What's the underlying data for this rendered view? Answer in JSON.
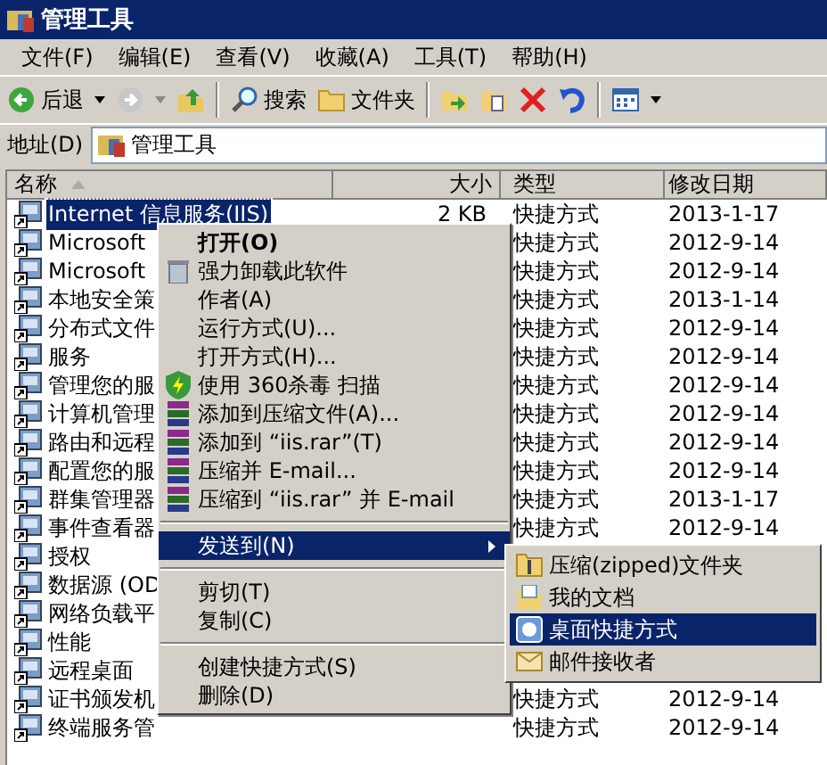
{
  "window": {
    "title": "管理工具"
  },
  "menu_bar": [
    "文件(F)",
    "编辑(E)",
    "查看(V)",
    "收藏(A)",
    "工具(T)",
    "帮助(H)"
  ],
  "toolbar": {
    "back": "后退",
    "search": "搜索",
    "folders": "文件夹"
  },
  "address_bar": {
    "label": "地址(D)",
    "value": "管理工具"
  },
  "table": {
    "columns": [
      {
        "label": "名称",
        "sorted": true
      },
      {
        "label": "大小",
        "sorted": false
      },
      {
        "label": "类型",
        "sorted": false
      },
      {
        "label": "修改日期",
        "sorted": false
      }
    ],
    "rows": [
      {
        "name": "Internet 信息服务(IIS)",
        "size": "2 KB",
        "type": "快捷方式",
        "modified": "2013-1-17",
        "selected": true
      },
      {
        "name": "Microsoft",
        "type": "快捷方式",
        "modified": "2012-9-14",
        "selected": false
      },
      {
        "name": "Microsoft",
        "type": "快捷方式",
        "modified": "2012-9-14",
        "selected": false
      },
      {
        "name": "本地安全策",
        "type": "快捷方式",
        "modified": "2013-1-14",
        "selected": false
      },
      {
        "name": "分布式文件",
        "type": "快捷方式",
        "modified": "2012-9-14",
        "selected": false
      },
      {
        "name": "服务",
        "type": "快捷方式",
        "modified": "2012-9-14",
        "selected": false
      },
      {
        "name": "管理您的服",
        "type": "快捷方式",
        "modified": "2012-9-14",
        "selected": false
      },
      {
        "name": "计算机管理",
        "type": "快捷方式",
        "modified": "2012-9-14",
        "selected": false
      },
      {
        "name": "路由和远程",
        "type": "快捷方式",
        "modified": "2012-9-14",
        "selected": false
      },
      {
        "name": "配置您的服",
        "type": "快捷方式",
        "modified": "2012-9-14",
        "selected": false
      },
      {
        "name": "群集管理器",
        "type": "快捷方式",
        "modified": "2013-1-17",
        "selected": false
      },
      {
        "name": "事件查看器",
        "type": "快捷方式",
        "modified": "2012-9-14",
        "selected": false
      },
      {
        "name": "授权",
        "selected": false
      },
      {
        "name": "数据源 (OD",
        "selected": false
      },
      {
        "name": "网络负载平",
        "selected": false
      },
      {
        "name": "性能",
        "selected": false
      },
      {
        "name": "远程桌面",
        "selected": false
      },
      {
        "name": "证书颁发机",
        "type": "快捷方式",
        "modified": "2012-9-14",
        "selected": false
      },
      {
        "name": "终端服务管",
        "type": "快捷方式",
        "modified": "2012-9-14",
        "selected": false
      }
    ]
  },
  "context_menu": [
    {
      "kind": "item",
      "label": "打开(O)",
      "default": true,
      "selected": false
    },
    {
      "kind": "item",
      "label": "强力卸载此软件",
      "selected": false
    },
    {
      "kind": "item",
      "label": "作者(A)",
      "selected": false
    },
    {
      "kind": "item",
      "label": "运行方式(U)...",
      "selected": false
    },
    {
      "kind": "item",
      "label": "打开方式(H)...",
      "selected": false
    },
    {
      "kind": "item",
      "label": "使用 360杀毒 扫描",
      "selected": false
    },
    {
      "kind": "item",
      "label": "添加到压缩文件(A)...",
      "selected": false
    },
    {
      "kind": "item",
      "label": "添加到 “iis.rar”(T)",
      "selected": false
    },
    {
      "kind": "item",
      "label": "压缩并 E-mail...",
      "selected": false
    },
    {
      "kind": "item",
      "label": "压缩到 “iis.rar” 并 E-mail",
      "selected": false
    },
    {
      "kind": "separator"
    },
    {
      "kind": "submenu",
      "label": "发送到(N)",
      "selected": true
    },
    {
      "kind": "separator"
    },
    {
      "kind": "item",
      "label": "剪切(T)",
      "selected": false
    },
    {
      "kind": "item",
      "label": "复制(C)",
      "selected": false
    },
    {
      "kind": "separator"
    },
    {
      "kind": "item",
      "label": "创建快捷方式(S)",
      "selected": false
    },
    {
      "kind": "item",
      "label": "删除(D)",
      "selected": false
    }
  ],
  "submenu": [
    {
      "label": "压缩(zipped)文件夹",
      "selected": false
    },
    {
      "label": "我的文档",
      "selected": false
    },
    {
      "label": "桌面快捷方式",
      "selected": true
    },
    {
      "label": "邮件接收者",
      "selected": false
    }
  ]
}
